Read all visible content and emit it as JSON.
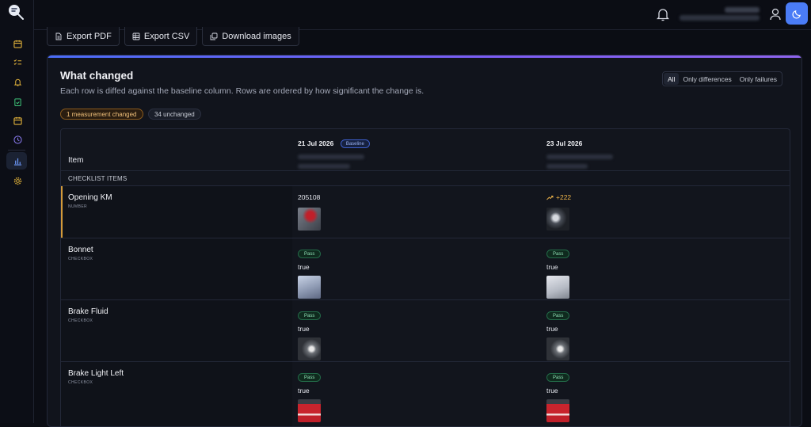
{
  "toolbar": {
    "export_pdf": "Export PDF",
    "export_csv": "Export CSV",
    "download_images": "Download images"
  },
  "card": {
    "title": "What changed",
    "subtitle": "Each row is diffed against the baseline column. Rows are ordered by how significant the change is."
  },
  "filters": {
    "all": "All",
    "only_differences": "Only differences",
    "only_failures": "Only failures",
    "selected": "All"
  },
  "summary": {
    "changed": "1 measurement changed",
    "unchanged": "34 unchanged"
  },
  "table": {
    "item_header": "Item",
    "columns": [
      {
        "date": "21 Jul 2026",
        "badge": "Baseline"
      },
      {
        "date": "23 Jul 2026",
        "badge": ""
      }
    ],
    "section_label": "CHECKLIST ITEMS",
    "rows": [
      {
        "name": "Opening KM",
        "type": "NUMBER",
        "baseline_value": "205108",
        "compare_delta": "+222"
      },
      {
        "name": "Bonnet",
        "type": "CHECKBOX",
        "baseline_status": "Pass",
        "baseline_value": "true",
        "compare_status": "Pass",
        "compare_value": "true"
      },
      {
        "name": "Brake Fluid",
        "type": "CHECKBOX",
        "baseline_status": "Pass",
        "baseline_value": "true",
        "compare_status": "Pass",
        "compare_value": "true"
      },
      {
        "name": "Brake Light Left",
        "type": "CHECKBOX",
        "baseline_status": "Pass",
        "baseline_value": "true",
        "compare_status": "Pass",
        "compare_value": "true"
      }
    ]
  },
  "icons": {
    "sidebar": [
      "calendar-icon",
      "checklist-icon",
      "bell-icon",
      "clipboard-check-icon",
      "calendar-icon",
      "clock-icon",
      "bar-chart-icon",
      "gear-icon"
    ],
    "topbar": [
      "bell-icon",
      "user-icon",
      "moon-icon"
    ]
  },
  "colors": {
    "accent": "#4a7cf6",
    "changed": "#d49a3a",
    "pass": "#8fe0b5",
    "sidebar_icon": "#e0b13a"
  }
}
